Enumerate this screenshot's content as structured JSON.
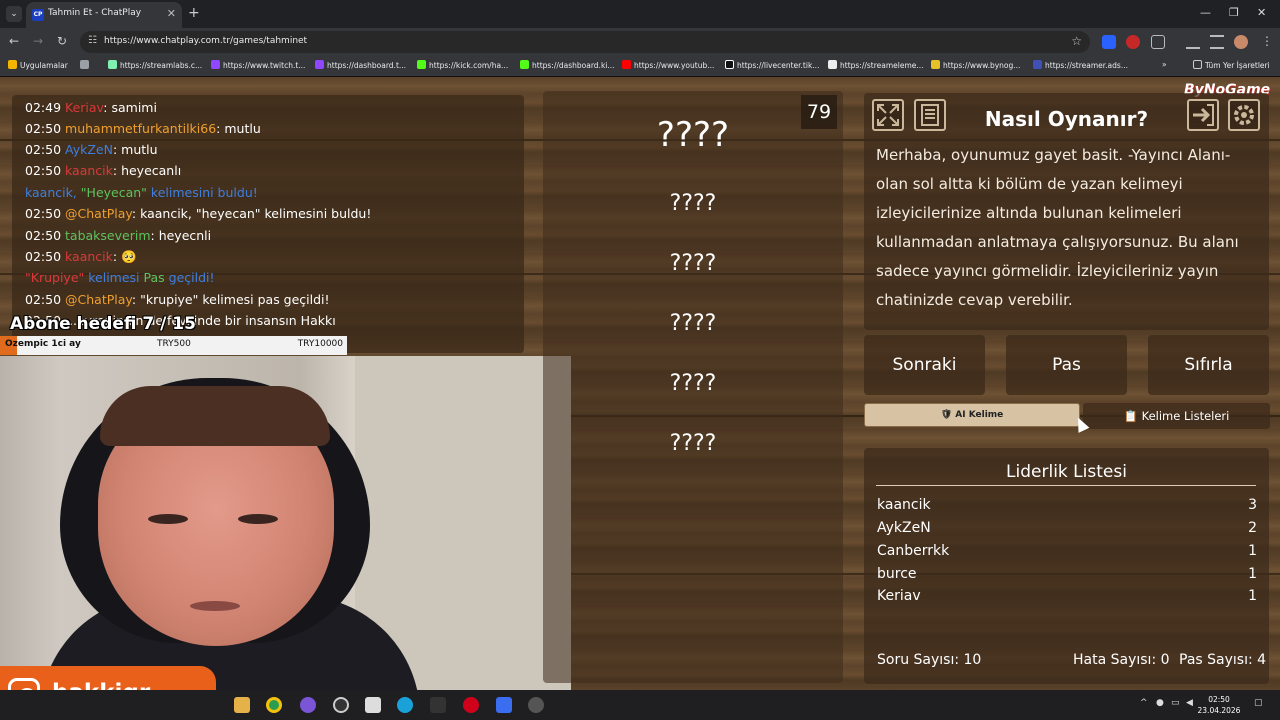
{
  "browser": {
    "tab_title": "Tahmin Et - ChatPlay",
    "tab_favicon": "CP",
    "url": "https://www.chatplay.com.tr/games/tahminet",
    "bookmarks_apps": "Uygulamalar",
    "bookmarks": [
      "https://streamlabs.c...",
      "https://www.twitch.t...",
      "https://dashboard.t...",
      "https://kick.com/ha...",
      "https://dashboard.ki...",
      "https://www.youtub...",
      "https://livecenter.tik...",
      "https://streameleme...",
      "https://www.bynog...",
      "https://streamer.ads..."
    ],
    "all_bookmarks": "Tüm Yer İşaretleri"
  },
  "chat": {
    "lines": [
      {
        "time": "02:49",
        "user": "Keriav",
        "sep": ": ",
        "msg": "samimi"
      },
      {
        "time": "02:50",
        "user": "muhammetfurkantilki66",
        "sep": ": ",
        "msg": "mutlu"
      },
      {
        "time": "02:50",
        "user": "AykZeN",
        "sep": ": ",
        "msg": "mutlu"
      },
      {
        "time": "02:50",
        "user": "kaancik",
        "sep": ": ",
        "msg": "heyecanlı"
      },
      {
        "a": "kaancik, ",
        "b": "\"Heyecan\"",
        "c": " kelimesini buldu!"
      },
      {
        "time": "02:50",
        "user": "@ChatPlay",
        "sep": ": ",
        "msg": "kaancik, \"heyecan\" kelimesini buldu!"
      },
      {
        "time": "02:50",
        "user": "tabakseverim",
        "sep": ": ",
        "msg": "heyecnli"
      },
      {
        "time": "02:50",
        "user": "kaancik",
        "sep": ": ",
        "msg": "🥺"
      },
      {
        "a": "\"Krupiye\"",
        "b": " kelimesi ",
        "c": "Pas",
        "d": " geçildi!"
      },
      {
        "time": "02:50",
        "user": "@ChatPlay",
        "sep": ": ",
        "msg": "\"krupiye\" kelimesi pas geçildi!"
      },
      {
        "time": "02:50",
        "user": "",
        "sep": "",
        "msg": "...evrenin en de fevkinde bir insansın Hakkı"
      }
    ]
  },
  "overlay": {
    "sub_goal": "Abone hedefi 7 / 15",
    "goal_name": "Ozempic 1ci ay",
    "goal_current": "TRY500",
    "goal_target": "TRY10000",
    "goal_progress": 0.05,
    "handle": "hakkigr"
  },
  "game": {
    "timer": "79",
    "main_word": "????",
    "words": [
      "????",
      "????",
      "????",
      "????",
      "????"
    ]
  },
  "help": {
    "title": "Nasıl Oynanır?",
    "body": "Merhaba, oyunumuz gayet basit. -Yayıncı Alanı-olan sol altta ki bölüm de yazan kelimeyi izleyicilerinize altında bulunan kelimeleri kullanmadan anlatmaya çalışıyorsunuz. Bu alanı sadece yayıncı görmelidir. İzleyicileriniz yayın chatinizde cevap verebilir.",
    "icons": [
      "fullscreen-icon",
      "document-icon",
      "exit-icon",
      "gear-icon"
    ]
  },
  "controls": {
    "next": "Sonraki",
    "pass": "Pas",
    "reset": "Sıfırla",
    "ai_word": "🛡 AI Kelime",
    "word_lists": "📋 Kelime Listeleri"
  },
  "leaderboard": {
    "title": "Liderlik Listesi",
    "rows": [
      {
        "name": "kaancik",
        "score": "3"
      },
      {
        "name": "AykZeN",
        "score": "2"
      },
      {
        "name": "Canberrkk",
        "score": "1"
      },
      {
        "name": "burce",
        "score": "1"
      },
      {
        "name": "Keriav",
        "score": "1"
      }
    ],
    "questions": "Soru Sayısı: 10",
    "errors": "Hata Sayısı: 0",
    "passes": "Pas Sayısı: 4"
  },
  "brand": "ByNoGame",
  "taskbar": {
    "time": "02:50",
    "date": "23.04.2026"
  }
}
